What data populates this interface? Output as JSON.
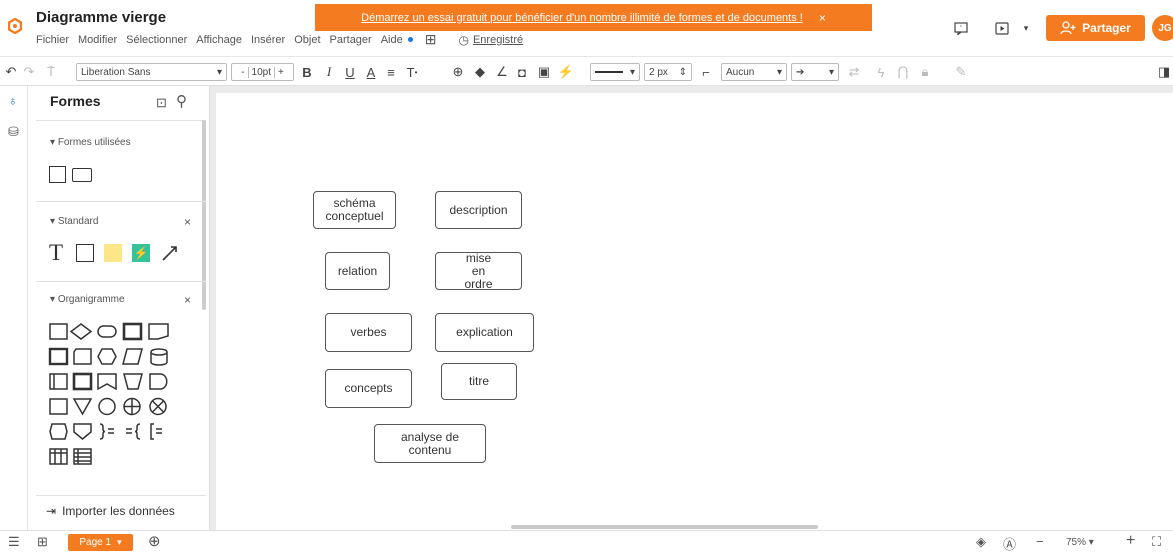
{
  "header": {
    "title": "Diagramme vierge",
    "menu": [
      "Fichier",
      "Modifier",
      "Sélectionner",
      "Affichage",
      "Insérer",
      "Objet",
      "Partager",
      "Aide"
    ],
    "saved_label": "Enregistré",
    "promo_text": "Démarrez un essai gratuit pour bénéficier d'un nombre illimité de formes et de documents !",
    "promo_close": "×",
    "share_label": "Partager",
    "avatar_initials": "JG",
    "brand_color": "#f47b20"
  },
  "toolbar": {
    "font": "Liberation Sans",
    "font_size": "10pt",
    "minus": "-",
    "plus": "+",
    "bold": "B",
    "italic": "I",
    "underline": "U",
    "font_color": "A",
    "align": "≡",
    "text_size": "T",
    "line_width": "2 px",
    "waypoints": "Aucun"
  },
  "sidebar": {
    "title": "Formes",
    "sections": [
      {
        "label": "Formes utilisées",
        "closable": false
      },
      {
        "label": "Standard",
        "closable": true
      },
      {
        "label": "Organigramme",
        "closable": true
      }
    ],
    "close_glyph": "×",
    "standard_text_glyph": "T",
    "import_label": "Importer les données"
  },
  "canvas": {
    "nodes": [
      {
        "id": "schema",
        "label": "schéma conceptuel"
      },
      {
        "id": "description",
        "label": "description"
      },
      {
        "id": "relation",
        "label": "relation"
      },
      {
        "id": "mise-en-ordre",
        "label": "mise en ordre"
      },
      {
        "id": "verbes",
        "label": "verbes"
      },
      {
        "id": "explication",
        "label": "explication"
      },
      {
        "id": "concepts",
        "label": "concepts"
      },
      {
        "id": "titre",
        "label": "titre"
      },
      {
        "id": "analyse",
        "label": "analyse de contenu"
      }
    ]
  },
  "footer": {
    "page_label": "Page 1",
    "zoom": "75%",
    "zoom_minus": "−",
    "zoom_plus": "+"
  }
}
